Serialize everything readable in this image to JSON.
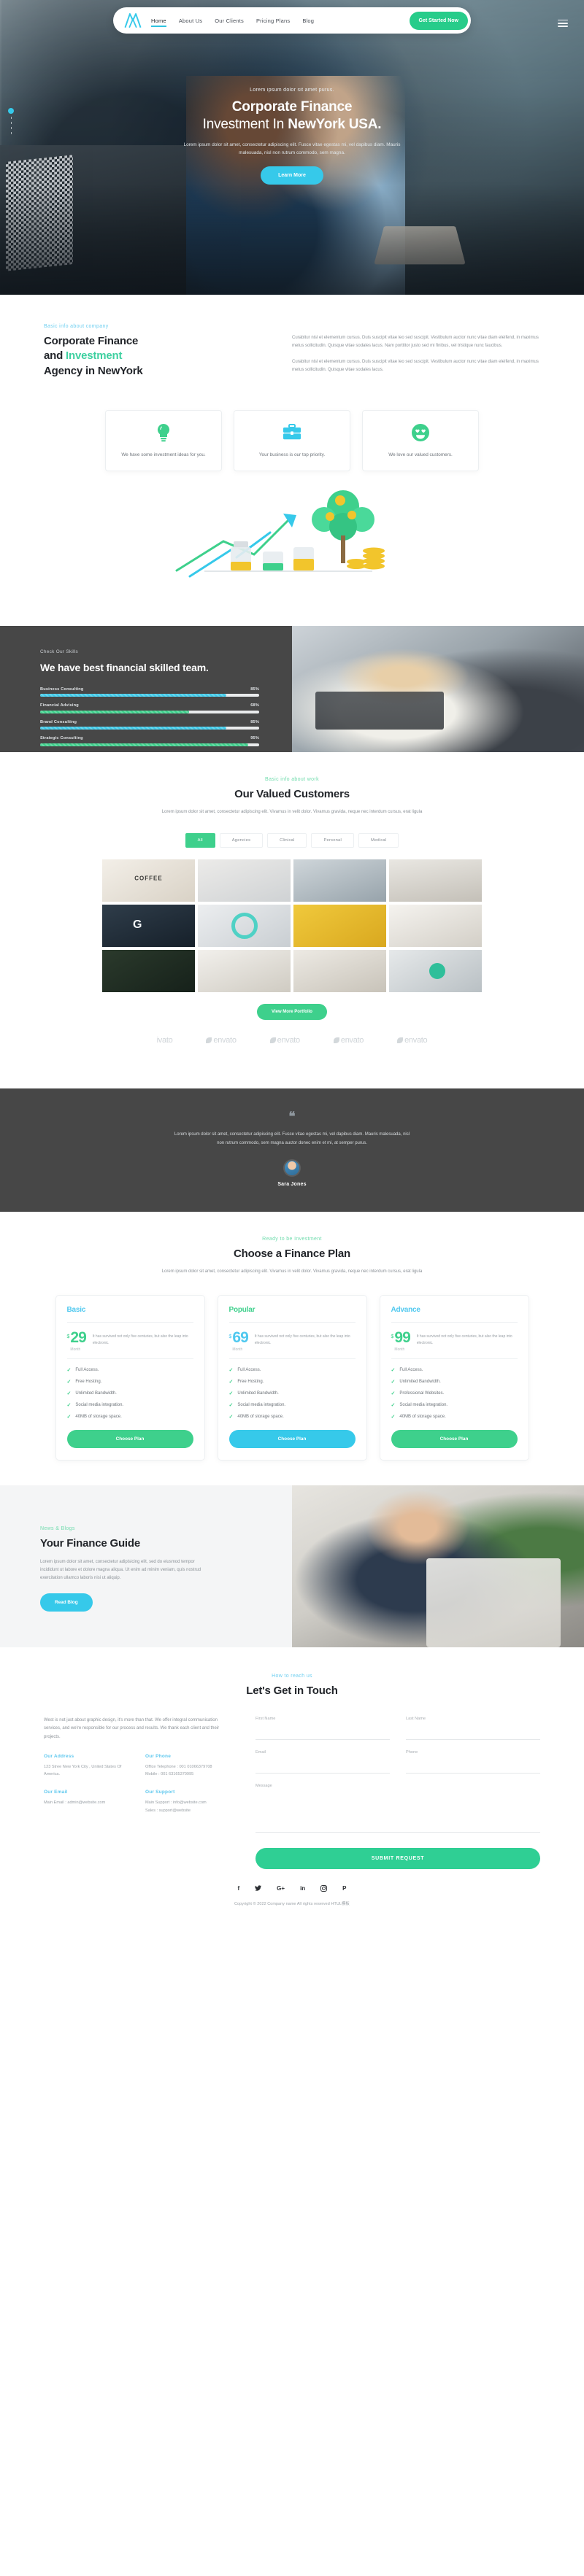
{
  "nav": {
    "logo_icon": "m-logo-icon",
    "links": [
      {
        "label": "Home",
        "active": true
      },
      {
        "label": "About Us",
        "active": false
      },
      {
        "label": "Our Clients",
        "active": false
      },
      {
        "label": "Pricing Plans",
        "active": false
      },
      {
        "label": "Blog",
        "active": false
      }
    ],
    "cta": "Get Started Now",
    "menu_icon": "hamburger-icon"
  },
  "hero": {
    "eyebrow": "Lorem ipsum dolor sit amet purus.",
    "title_line1": "Corporate Finance",
    "title_line2_light": "Investment In ",
    "title_line2_bold": "NewYork USA.",
    "paragraph": "Lorem ipsum dolor sit amet, consectetur adipiscing elit. Fusce vitae egestas mi, vel dapibus diam. Mauris malesuada, nisl non rutrum commodo, sem magna.",
    "button": "Learn More"
  },
  "about": {
    "eyebrow": "Basic info about company",
    "title_a": "Corporate Finance",
    "title_b": "and ",
    "title_accent": "Investment",
    "title_c": "Agency in NewYork",
    "paragraph1": "Curabitur nisl et elementum cursus. Duis suscipit vitae leo sed suscipit. Vestibulum auctor nunc vitae diam eleifend, in maximus metus sollicitudin. Quisque vitae sodales lacus. Nam porttitor justo sed mi finibus, vel tristique nunc faucibus.",
    "paragraph2": "Curabitur nisl et elementum cursus. Duis suscipit vitae leo sed suscipit. Vestibulum auctor nunc vitae diam eleifend, in maximus metus sollicitudin. Quisque vitae sodales lacus.",
    "cards": [
      {
        "icon": "lightbulb-icon",
        "text": "We have some investment ideas for you."
      },
      {
        "icon": "briefcase-icon",
        "text": "Your business is our top priority."
      },
      {
        "icon": "smiley-heart-eyes-icon",
        "text": "We love our valued customers."
      }
    ]
  },
  "skills": {
    "eyebrow": "Check Our Skills",
    "title": "We have best financial skilled team.",
    "bars": [
      {
        "label": "Business Consulting",
        "value": 85,
        "display": "85%",
        "color": "#3ec9e8"
      },
      {
        "label": "Financial Advising",
        "value": 68,
        "display": "68%",
        "color": "#3ed08c"
      },
      {
        "label": "Brand Consulting",
        "value": 85,
        "display": "85%",
        "color": "#3ec9e8"
      },
      {
        "label": "Strategic Consulting",
        "value": 95,
        "display": "95%",
        "color": "#3ed08c"
      }
    ]
  },
  "portfolio": {
    "eyebrow": "Basic info about work",
    "title": "Our Valued Customers",
    "paragraph": "Lorem ipsum dolor sit amet, consectetur adipiscing elit. Vivamus in velit dolor. Vivamus gravida, neque nec interdum cursus, erat ligula",
    "filters": [
      {
        "label": "All",
        "active": true
      },
      {
        "label": "Agencies",
        "active": false
      },
      {
        "label": "Clinical",
        "active": false
      },
      {
        "label": "Personal",
        "active": false
      },
      {
        "label": "Medical",
        "active": false
      }
    ],
    "tile_count": 12,
    "button": "View More Portfolio",
    "brands": [
      "ivato",
      "envato",
      "envato",
      "envato",
      "envato"
    ]
  },
  "testimonial": {
    "quote_icon": "quote-icon",
    "text": "Lorem ipsum dolor sit amet, consectetur adipiscing elit. Fusce vitae egestas mi, vel dapibus diam. Mauris malesuada, nisl non rutrum commodo, sem magna auctor donec enim et mi, at semper purus.",
    "author": "Sara Jones"
  },
  "pricing": {
    "eyebrow": "Ready to be Investment",
    "title": "Choose a Finance Plan",
    "paragraph": "Lorem ipsum dolor sit amet, consectetur adipiscing elit. Vivamus in velit dolor. Vivamus gravida, neque nec interdum cursus, erat ligula",
    "plans": [
      {
        "name": "Basic",
        "name_color": "#4fc8ef",
        "currency": "$",
        "amount": "29",
        "per": "Month",
        "desc": "It has survived not only five centuries, but also the leap into electronic.",
        "features": [
          "Full Access.",
          "Free Hosting.",
          "Unlimited Bandwidth.",
          "Social media integration.",
          "40MB of storage space."
        ],
        "button": "Choose Plan",
        "button_color": "#3ed08c",
        "amount_color": "#3ed08c"
      },
      {
        "name": "Popular",
        "name_color": "#3ed08c",
        "currency": "$",
        "amount": "69",
        "per": "Month",
        "desc": "It has survived not only five centuries, but also the leap into electronic.",
        "features": [
          "Full Access.",
          "Free Hosting.",
          "Unlimited Bandwidth.",
          "Social media integration.",
          "40MB of storage space."
        ],
        "button": "Choose Plan",
        "button_color": "#36c9ea",
        "amount_color": "#4fc8ef"
      },
      {
        "name": "Advance",
        "name_color": "#4fc8ef",
        "currency": "$",
        "amount": "99",
        "per": "Month",
        "desc": "It has survived not only five centuries, but also the leap into electronic.",
        "features": [
          "Full Access.",
          "Unlimited Bandwidth.",
          "Professional Websites.",
          "Social media integration.",
          "40MB of storage space."
        ],
        "button": "Choose Plan",
        "button_color": "#3ed08c",
        "amount_color": "#3ed08c"
      }
    ]
  },
  "blog": {
    "eyebrow": "News & Blogs",
    "title": "Your Finance Guide",
    "paragraph": "Lorem ipsum dolor sit amet, consectetur adipisicing elit, sed do eiusmod tempor incididunt ut labore et dolore magna aliqua. Ut enim ad minim veniam, quis nostrud exercitation ullamco laboris nisi ut aliquip.",
    "button": "Read Blog"
  },
  "contact": {
    "eyebrow": "How to reach us",
    "title": "Let's Get in Touch",
    "intro": "West is not just about graphic design, it's more than that. We offer integral communication services, and we're responsible for our process and results. We thank each client and their projects.",
    "blocks": [
      {
        "title": "Our Address",
        "lines": [
          "123 Stree New York City , United States Of America."
        ]
      },
      {
        "title": "Our Phone",
        "lines": [
          "Office Telephone : 001 01066379708",
          "Mobile : 001 63165370995"
        ]
      },
      {
        "title": "Our Email",
        "lines": [
          "Main Email : admin@website.com"
        ]
      },
      {
        "title": "Our Support",
        "lines": [
          "Main Support : info@website.com",
          "Sales : support@website"
        ]
      }
    ],
    "form": {
      "first_name_label": "First Name",
      "first_name_value": "",
      "last_name_label": "Last Name",
      "last_name_value": "",
      "email_label": "Email",
      "email_value": "",
      "phone_label": "Phone",
      "phone_value": "",
      "message_label": "Message",
      "message_value": "",
      "submit": "SUBMIT REQUEST"
    }
  },
  "footer": {
    "socials": [
      {
        "icon": "facebook-icon",
        "glyph": "f"
      },
      {
        "icon": "twitter-icon",
        "glyph": "ᴛ"
      },
      {
        "icon": "google-plus-icon",
        "glyph": "G+"
      },
      {
        "icon": "linkedin-icon",
        "glyph": "in"
      },
      {
        "icon": "instagram-icon",
        "glyph": "□"
      },
      {
        "icon": "pinterest-icon",
        "glyph": "P"
      }
    ],
    "copyright": "Copyright © 2022 Company name All rights reserved HTUL模板"
  },
  "colors": {
    "green": "#3ed08c",
    "blue": "#36c9ea",
    "dark": "#474747"
  }
}
